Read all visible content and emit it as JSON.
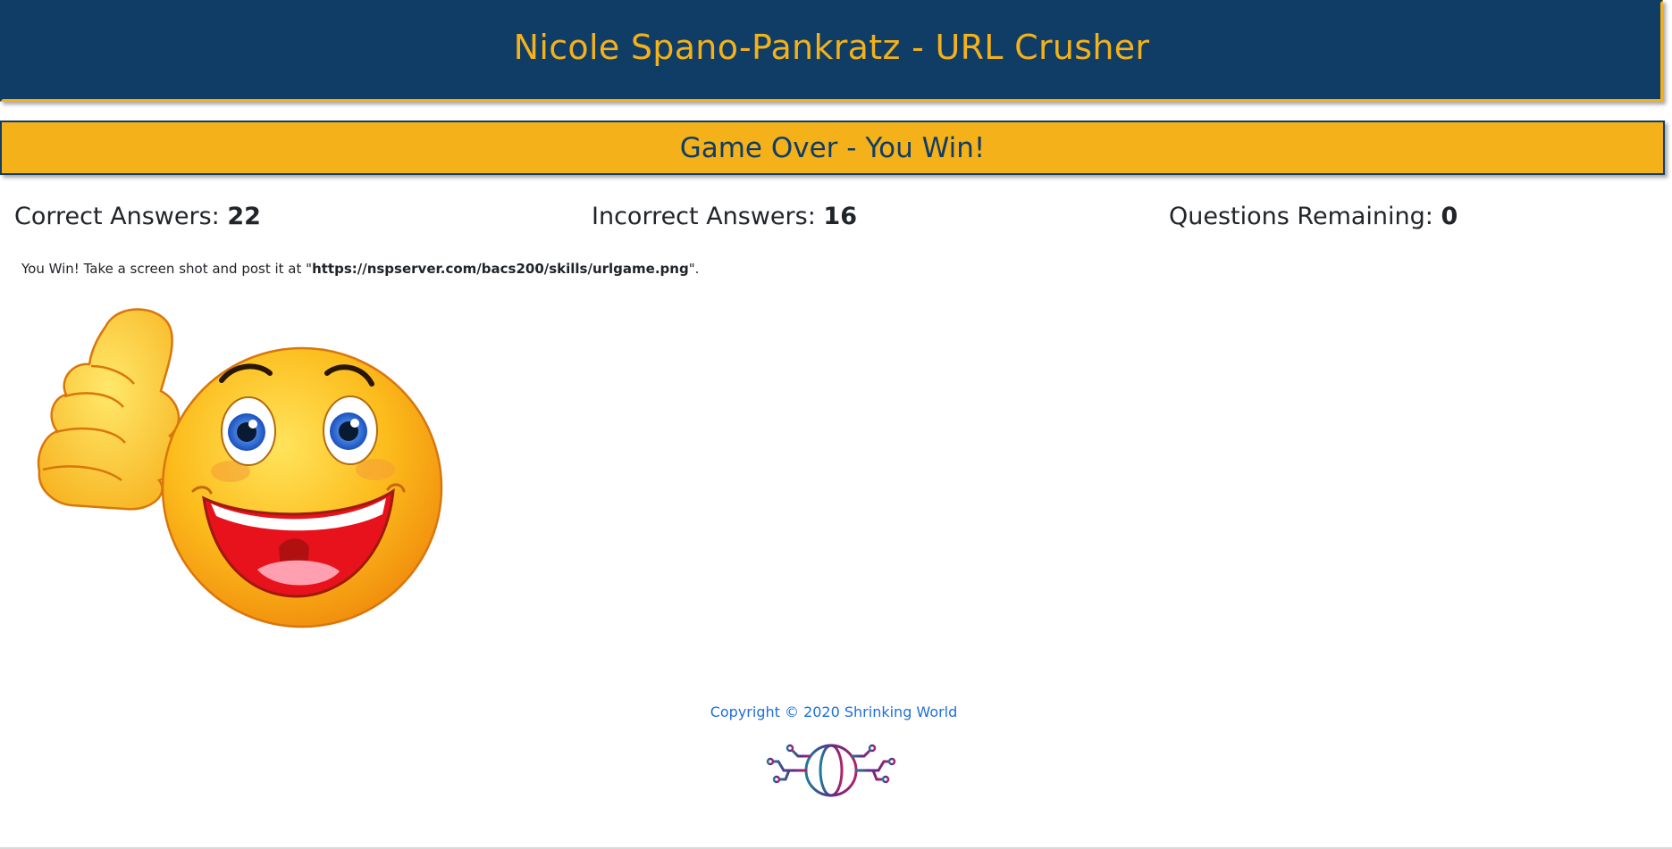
{
  "header": {
    "title": "Nicole Spano-Pankratz - URL Crusher"
  },
  "status": {
    "text": "Game Over - You Win!"
  },
  "scores": {
    "correct_label": "Correct Answers:",
    "correct_value": "22",
    "incorrect_label": "Incorrect Answers:",
    "incorrect_value": "16",
    "remaining_label": "Questions Remaining:",
    "remaining_value": "0"
  },
  "message": {
    "prefix": "You Win! Take a screen shot and post it at \"",
    "url": "https://nspserver.com/bacs200/skills/urlgame.png",
    "suffix": "\"."
  },
  "footer": {
    "copyright": "Copyright © 2020 Shrinking World"
  },
  "colors": {
    "navy": "#103d66",
    "gold": "#f4b11a",
    "link_blue": "#1e6fd9"
  },
  "icons": {
    "emoji": "thumbs-up-smiley-icon",
    "logo": "globe-circuit-logo-icon"
  }
}
